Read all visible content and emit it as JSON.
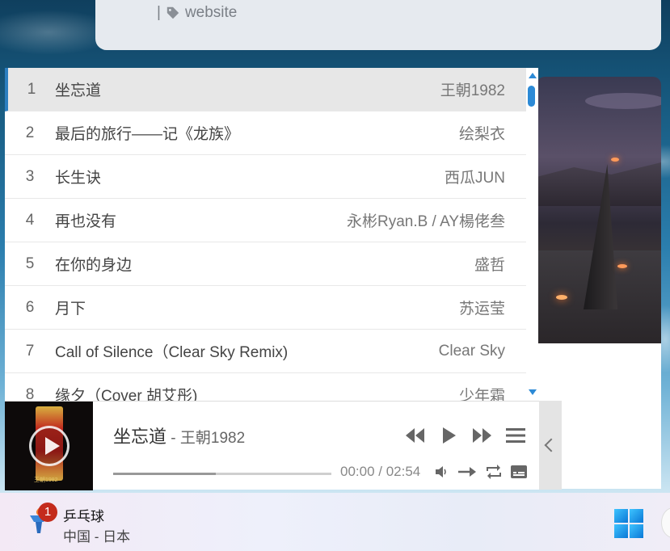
{
  "post": {
    "separator": "|",
    "tag": "website"
  },
  "playlist": [
    {
      "index": "1",
      "title": "坐忘道",
      "artist": "王朝1982",
      "active": true
    },
    {
      "index": "2",
      "title": "最后的旅行——记《龙族》",
      "artist": "绘梨衣"
    },
    {
      "index": "3",
      "title": "长生诀",
      "artist": "西瓜JUN"
    },
    {
      "index": "4",
      "title": "再也没有",
      "artist": "永彬Ryan.B / AY楊佬叁"
    },
    {
      "index": "5",
      "title": "在你的身边",
      "artist": "盛哲"
    },
    {
      "index": "6",
      "title": "月下",
      "artist": "苏运莹"
    },
    {
      "index": "7",
      "title": "Call of Silence（Clear Sky Remix)",
      "artist": "Clear Sky"
    },
    {
      "index": "8",
      "title": "缘夕（Cover 胡艾彤)",
      "artist": "少年霜"
    }
  ],
  "player": {
    "title": "坐忘道",
    "artist": "王朝1982",
    "cover_caption": "王朝1982",
    "current_time": "00:00",
    "duration": "02:54",
    "buffered_fraction": 0.47
  },
  "taskbar": {
    "badge": "1",
    "title": "乒乓球",
    "subtitle": "中国 - 日本"
  },
  "colors": {
    "accent": "#2c7fc0",
    "scroll": "#2c8ad6"
  }
}
